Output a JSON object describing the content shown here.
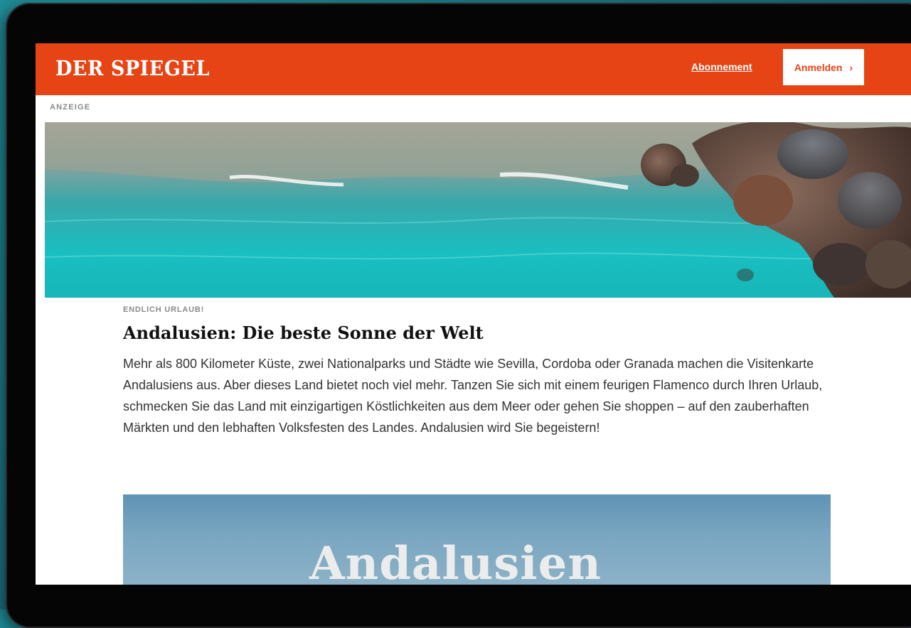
{
  "header": {
    "logo": "DER SPIEGEL",
    "subscription_link": "Abonnement",
    "login_button": "Anmelden",
    "login_chevron": "›"
  },
  "ad_label": "ANZEIGE",
  "article": {
    "kicker": "ENDLICH URLAUB!",
    "headline": "Andalusien: Die beste Sonne der Welt",
    "body": "Mehr als 800 Kilometer Küste, zwei Nationalparks und Städte wie Sevilla, Cordoba oder Granada machen die Visitenkarte Andalusiens aus. Aber dieses Land bietet noch viel mehr. Tanzen Sie sich mit einem feurigen Flamenco durch Ihren Urlaub, schmecken Sie das Land mit einzigartigen Köstlichkeiten aus dem Meer oder gehen Sie shoppen – auf den zauberhaften Märkten und den lebhaften Volksfesten des Landes. Andalusien wird Sie begeistern!"
  },
  "teaser": {
    "title": "Andalusien"
  },
  "colors": {
    "brand": "#e64415",
    "background": "#1a7a88"
  }
}
